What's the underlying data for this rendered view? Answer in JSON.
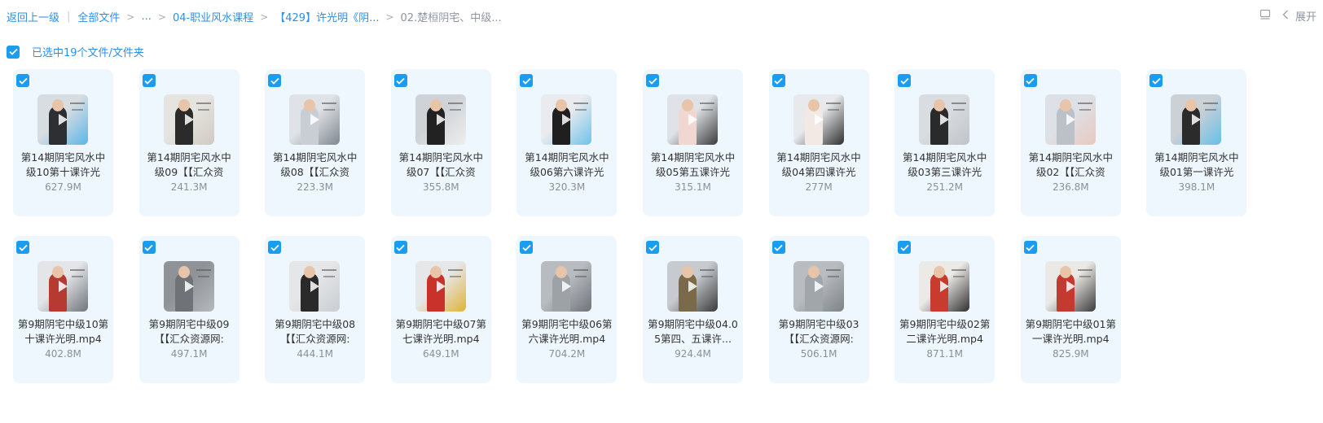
{
  "breadcrumb": {
    "back": "返回上一级",
    "root": "全部文件",
    "ellipsis": "...",
    "level1": "04-职业风水课程",
    "level2": "【429】许光明《阴...",
    "current": "02.楚桓阴宅、中级..."
  },
  "toolbar": {
    "expand_label": "展开"
  },
  "selection": {
    "label": "已选中19个文件/文件夹"
  },
  "files": [
    {
      "name": "第14期阴宅风水中级10第十课许光",
      "size": "627.9M"
    },
    {
      "name": "第14期阴宅风水中级09【【汇众资",
      "size": "241.3M"
    },
    {
      "name": "第14期阴宅风水中级08【【汇众资",
      "size": "223.3M"
    },
    {
      "name": "第14期阴宅风水中级07【【汇众资",
      "size": "355.8M"
    },
    {
      "name": "第14期阴宅风水中级06第六课许光",
      "size": "320.3M"
    },
    {
      "name": "第14期阴宅风水中级05第五课许光",
      "size": "315.1M"
    },
    {
      "name": "第14期阴宅风水中级04第四课许光",
      "size": "277M"
    },
    {
      "name": "第14期阴宅风水中级03第三课许光",
      "size": "251.2M"
    },
    {
      "name": "第14期阴宅风水中级02【【汇众资",
      "size": "236.8M"
    },
    {
      "name": "第14期阴宅风水中级01第一课许光",
      "size": "398.1M"
    },
    {
      "name": "第9期阴宅中级10第十课许光明.mp4",
      "size": "402.8M"
    },
    {
      "name": "第9期阴宅中级09【【汇众资源网:",
      "size": "497.1M"
    },
    {
      "name": "第9期阴宅中级08【【汇众资源网:",
      "size": "444.1M"
    },
    {
      "name": "第9期阴宅中级07第七课许光明.mp4",
      "size": "649.1M"
    },
    {
      "name": "第9期阴宅中级06第六课许光明.mp4",
      "size": "704.2M"
    },
    {
      "name": "第9期阴宅中级04.05第四、五课许...",
      "size": "924.4M"
    },
    {
      "name": "第9期阴宅中级03【【汇众资源网:",
      "size": "506.1M"
    },
    {
      "name": "第9期阴宅中级02第二课许光明.mp4",
      "size": "871.1M"
    },
    {
      "name": "第9期阴宅中级01第一课许光明.mp4",
      "size": "825.9M"
    }
  ],
  "colors": {
    "accent": "#1a9df0",
    "link": "#2f8fe5",
    "card_bg": "#eef7fd"
  },
  "icons": {
    "checkbox": "checkbox-checked-icon",
    "play": "play-icon",
    "chevron": "chevron-left-icon",
    "layout": "layout-icon"
  }
}
